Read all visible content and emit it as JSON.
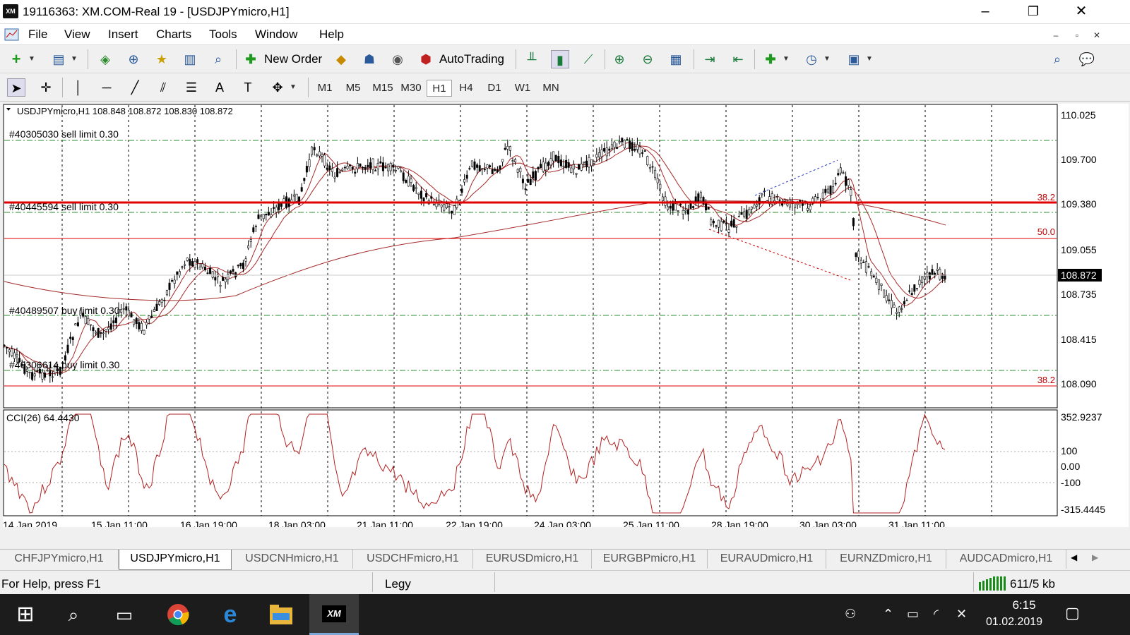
{
  "window": {
    "logo": "XM",
    "title": "19116363: XM.COM-Real 19 - [USDJPYmicro,H1]",
    "minimize": "–",
    "maximize": "❐",
    "close": "✕"
  },
  "menu": {
    "items": [
      "File",
      "View",
      "Insert",
      "Charts",
      "Tools",
      "Window",
      "Help"
    ],
    "mdi_min": "–",
    "mdi_restore": "▫",
    "mdi_close": "✕"
  },
  "toolbar": {
    "new_order": "New Order",
    "autotrading": "AutoTrading",
    "timeframes": [
      "M1",
      "M5",
      "M15",
      "M30",
      "H1",
      "H4",
      "D1",
      "W1",
      "MN"
    ],
    "active_timeframe": "H1"
  },
  "chart": {
    "header": "USDJPYmicro,H1  108.848 108.872 108.830 108.872",
    "price_labels": [
      "110.025",
      "109.700",
      "109.380",
      "109.055",
      "108.735",
      "108.415",
      "108.090"
    ],
    "current_price": "108.872",
    "orders": [
      "#40305030 sell limit 0.30",
      "#40445594 sell limit 0.30",
      "#40489507 buy limit 0.30",
      "#40306614 buy limit 0.30"
    ],
    "fibo_labels": [
      "38.2",
      "50.0",
      "38.2"
    ],
    "indicator_header": "CCI(26) 64.4430",
    "cci_labels": [
      "352.9237",
      "100",
      "0.00",
      "-100",
      "-315.4445"
    ],
    "time_labels": [
      "14 Jan 2019",
      "15 Jan 11:00",
      "16 Jan 19:00",
      "18 Jan 03:00",
      "21 Jan 11:00",
      "22 Jan 19:00",
      "24 Jan 03:00",
      "25 Jan 11:00",
      "28 Jan 19:00",
      "30 Jan 03:00",
      "31 Jan 11:00"
    ],
    "colors": {
      "candle": "#000000",
      "ma": "#a52a2a",
      "resistance": "#e00000",
      "order_line": "#2e8b2e",
      "cci": "#b22222"
    }
  },
  "tabs": {
    "items": [
      "CHFJPYmicro,H1",
      "USDJPYmicro,H1",
      "USDCNHmicro,H1",
      "USDCHFmicro,H1",
      "EURUSDmicro,H1",
      "EURGBPmicro,H1",
      "EURAUDmicro,H1",
      "EURNZDmicro,H1",
      "AUDCADmicro,H1"
    ],
    "active": "USDJPYmicro,H1"
  },
  "status": {
    "help": "For Help, press F1",
    "profile": "Legy",
    "traffic": "611/5 kb"
  },
  "taskbar": {
    "time": "6:15",
    "date": "01.02.2019",
    "xm": "XM"
  }
}
